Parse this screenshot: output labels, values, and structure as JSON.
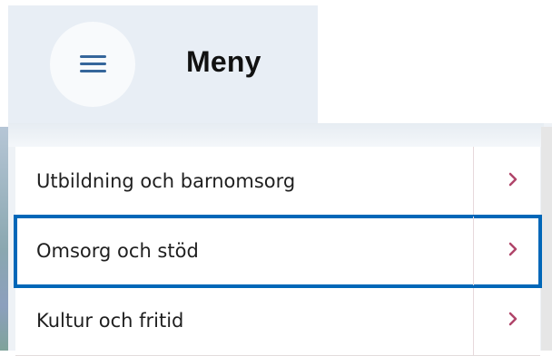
{
  "header": {
    "menu_title": "Meny",
    "menu_icon": "hamburger-icon",
    "accent_color": "#35669b"
  },
  "menu": {
    "items": [
      {
        "label": "Utbildning och barnomsorg",
        "icon": "chevron-right-icon",
        "focused": false
      },
      {
        "label": "Omsorg och stöd",
        "icon": "chevron-right-icon",
        "focused": true
      },
      {
        "label": "Kultur och fritid",
        "icon": "chevron-right-icon",
        "focused": false
      }
    ],
    "focus_color": "#0067b8",
    "chevron_color": "#b0456a"
  }
}
